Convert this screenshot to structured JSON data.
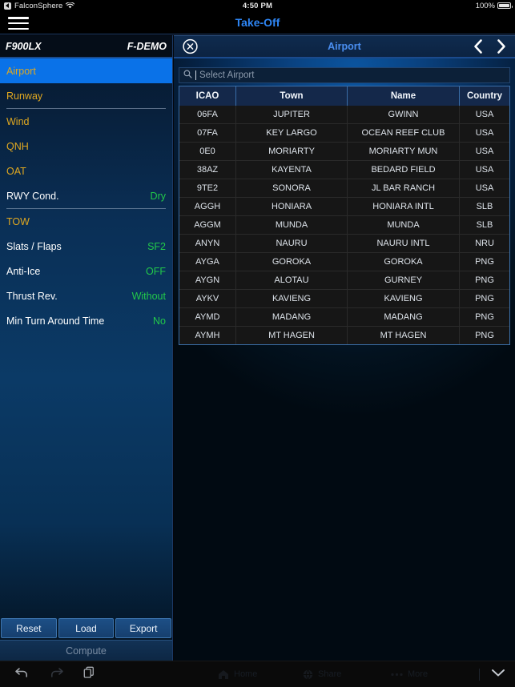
{
  "statusbar": {
    "back_chip": "◀",
    "app_name": "FalconSphere",
    "wifi_icon": "wifi-icon",
    "time": "4:50 PM",
    "battery_percent": "100%",
    "battery_icon": "battery-full-icon"
  },
  "appbar": {
    "menu_icon": "hamburger-menu-icon",
    "title": "Take-Off"
  },
  "sidebar": {
    "aircraft_type": "F900LX",
    "registration": "F-DEMO",
    "items": [
      {
        "label": "Airport",
        "value": "",
        "selected": true,
        "required": true,
        "separator_after": false
      },
      {
        "label": "Runway",
        "value": "",
        "selected": false,
        "required": true,
        "separator_after": true
      },
      {
        "label": "Wind",
        "value": "",
        "selected": false,
        "required": true,
        "separator_after": false
      },
      {
        "label": "QNH",
        "value": "",
        "selected": false,
        "required": true,
        "separator_after": false
      },
      {
        "label": "OAT",
        "value": "",
        "selected": false,
        "required": true,
        "separator_after": false
      },
      {
        "label": "RWY Cond.",
        "value": "Dry",
        "selected": false,
        "required": false,
        "separator_after": true
      },
      {
        "label": "TOW",
        "value": "",
        "selected": false,
        "required": true,
        "separator_after": false
      },
      {
        "label": "Slats / Flaps",
        "value": "SF2",
        "selected": false,
        "required": false,
        "separator_after": false
      },
      {
        "label": "Anti-Ice",
        "value": "OFF",
        "selected": false,
        "required": false,
        "separator_after": false
      },
      {
        "label": "Thrust Rev.",
        "value": "Without",
        "selected": false,
        "required": false,
        "separator_after": false
      },
      {
        "label": "Min Turn Around Time",
        "value": "No",
        "selected": false,
        "required": false,
        "separator_after": false
      }
    ],
    "buttons": {
      "reset": "Reset",
      "load": "Load",
      "export": "Export",
      "compute": "Compute"
    }
  },
  "panel": {
    "close_icon": "close-circle-icon",
    "title": "Airport",
    "prev_icon": "chevron-left-icon",
    "next_icon": "chevron-right-icon",
    "search": {
      "icon": "search-icon",
      "placeholder": "Select Airport",
      "value": ""
    },
    "table": {
      "columns": [
        "ICAO",
        "Town",
        "Name",
        "Country"
      ],
      "rows": [
        [
          "06FA",
          "JUPITER",
          "GWINN",
          "USA"
        ],
        [
          "07FA",
          "KEY LARGO",
          "OCEAN REEF CLUB",
          "USA"
        ],
        [
          "0E0",
          "MORIARTY",
          "MORIARTY MUN",
          "USA"
        ],
        [
          "38AZ",
          "KAYENTA",
          "BEDARD FIELD",
          "USA"
        ],
        [
          "9TE2",
          "SONORA",
          "JL BAR RANCH",
          "USA"
        ],
        [
          "AGGH",
          "HONIARA",
          "HONIARA INTL",
          "SLB"
        ],
        [
          "AGGM",
          "MUNDA",
          "MUNDA",
          "SLB"
        ],
        [
          "ANYN",
          "NAURU",
          "NAURU INTL",
          "NRU"
        ],
        [
          "AYGA",
          "GOROKA",
          "GOROKA",
          "PNG"
        ],
        [
          "AYGN",
          "ALOTAU",
          "GURNEY",
          "PNG"
        ],
        [
          "AYKV",
          "KAVIENG",
          "KAVIENG",
          "PNG"
        ],
        [
          "AYMD",
          "MADANG",
          "MADANG",
          "PNG"
        ],
        [
          "AYMH",
          "MT HAGEN",
          "MT HAGEN",
          "PNG"
        ]
      ]
    }
  },
  "bottombar": {
    "back_icon": "undo-arrow-icon",
    "forward_icon": "redo-arrow-icon",
    "tabs_icon": "copy-pages-icon",
    "ghost_items": [
      {
        "icon": "home-icon",
        "label": "Home"
      },
      {
        "icon": "globe-icon",
        "label": "Share"
      },
      {
        "icon": "more-icon",
        "label": "More"
      }
    ],
    "collapse_icon": "chevron-down-icon"
  },
  "colors": {
    "accent_blue": "#0a72e8",
    "title_blue": "#2e86f5",
    "required_yellow": "#e0a820",
    "value_green": "#22c94a",
    "table_border": "#3a6ea8"
  }
}
